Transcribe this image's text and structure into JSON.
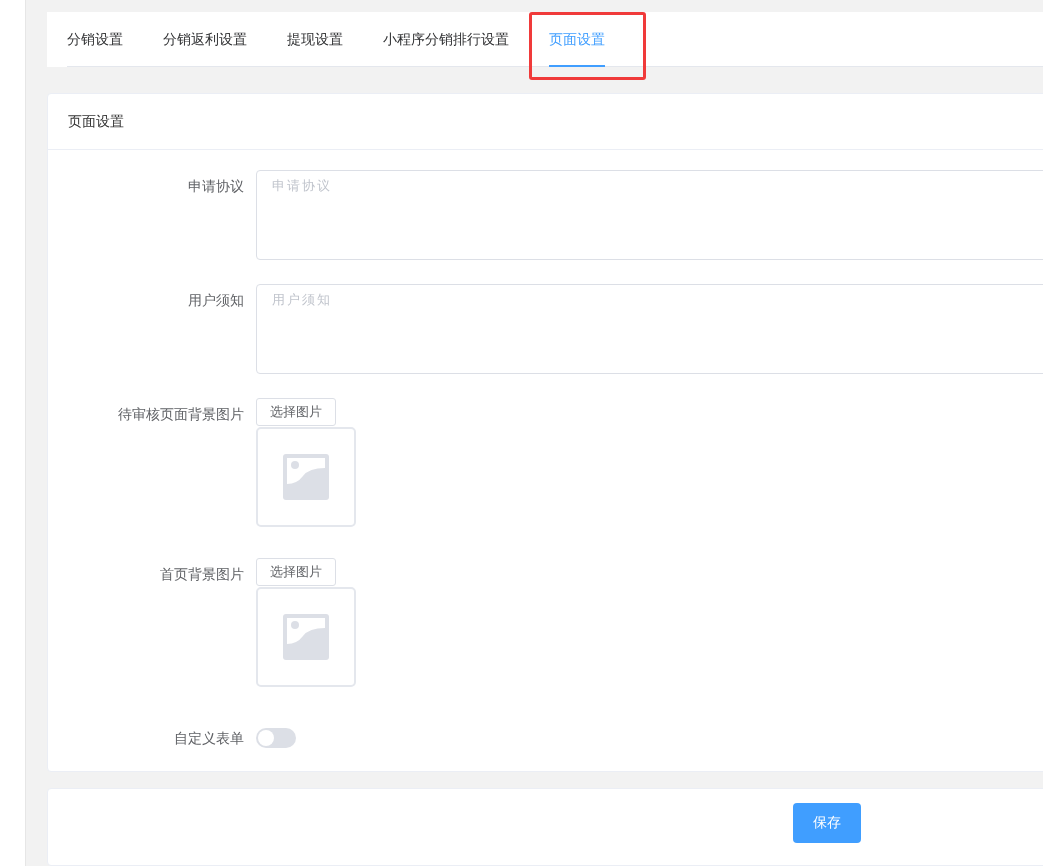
{
  "tabs": [
    {
      "label": "分销设置",
      "selected": false,
      "outlined": false
    },
    {
      "label": "分销返利设置",
      "selected": false,
      "outlined": false
    },
    {
      "label": "提现设置",
      "selected": false,
      "outlined": false
    },
    {
      "label": "小程序分销排行设置",
      "selected": false,
      "outlined": false
    },
    {
      "label": "页面设置",
      "selected": true,
      "outlined": true
    }
  ],
  "form": {
    "title": "页面设置",
    "fields": [
      {
        "kind": "textarea",
        "label": "申请协议",
        "placeholder": "申请协议"
      },
      {
        "kind": "textarea",
        "label": "用户须知",
        "placeholder": "用户须知"
      },
      {
        "kind": "image",
        "label": "待审核页面背景图片",
        "button": "选择图片"
      },
      {
        "kind": "image",
        "label": "首页背景图片",
        "button": "选择图片"
      },
      {
        "kind": "switch",
        "label": "自定义表单",
        "on": false
      }
    ]
  },
  "save_button": "保存"
}
